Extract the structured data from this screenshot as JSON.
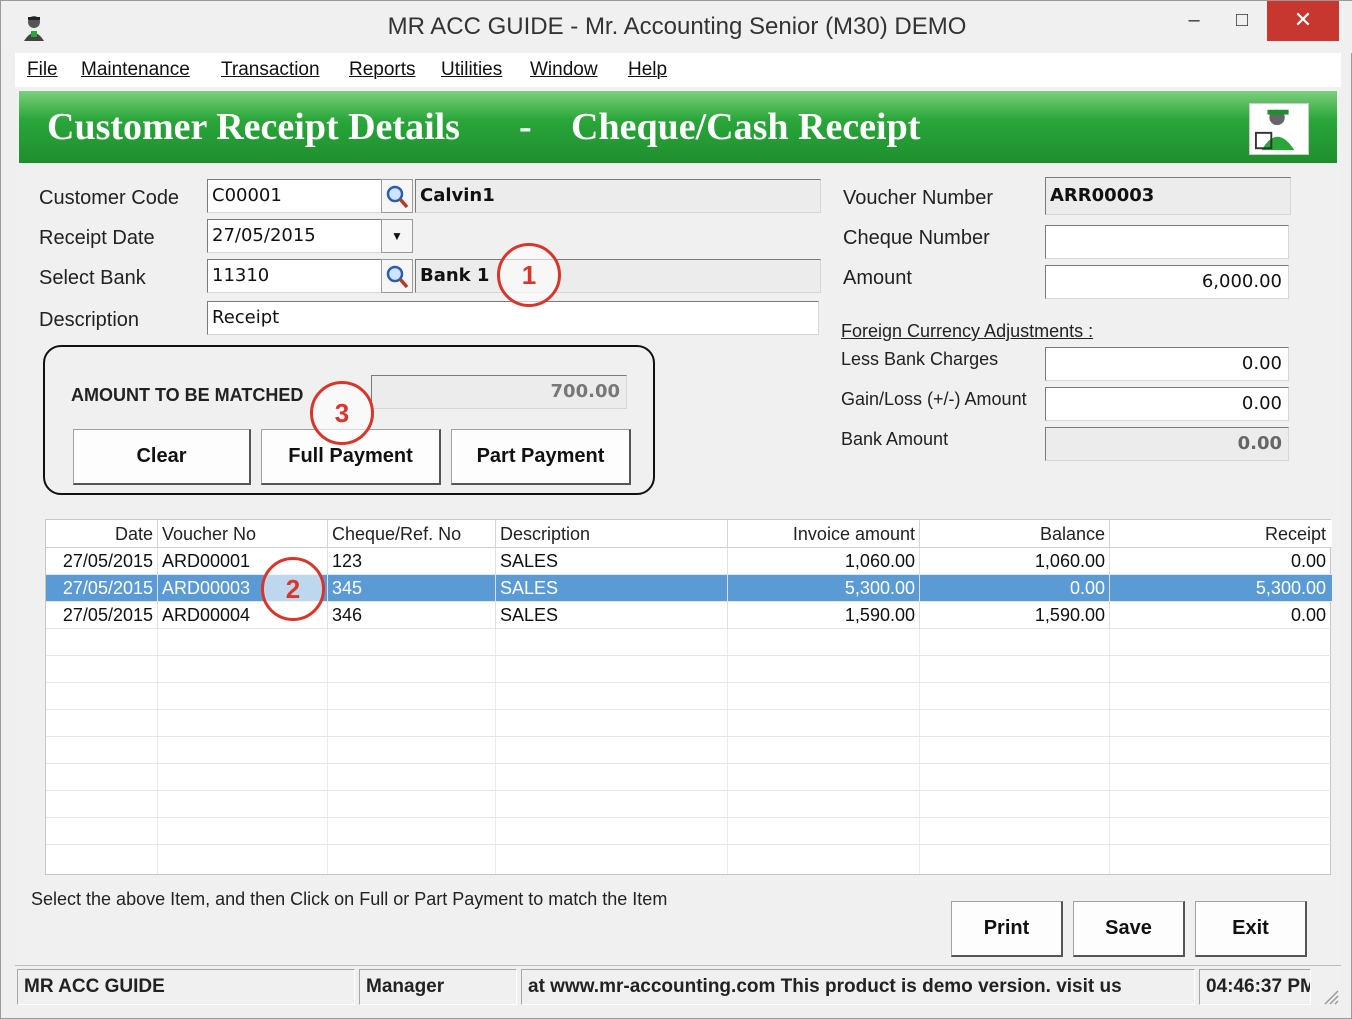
{
  "window": {
    "title": "MR ACC GUIDE - Mr. Accounting Senior (M30) DEMO",
    "min_glyph": "–",
    "max_glyph": "□",
    "close_glyph": "✕"
  },
  "menu": [
    "File",
    "Maintenance",
    "Transaction",
    "Reports",
    "Utilities",
    "Window",
    "Help"
  ],
  "banner": {
    "left": "Customer Receipt Details",
    "sep": "-",
    "right": "Cheque/Cash Receipt"
  },
  "form": {
    "customer_code_label": "Customer Code",
    "customer_code": "C00001",
    "customer_name": "Calvin1",
    "receipt_date_label": "Receipt Date",
    "receipt_date": "27/05/2015",
    "select_bank_label": "Select Bank",
    "bank_code": "11310",
    "bank_name": "Bank 1",
    "description_label": "Description",
    "description": "Receipt",
    "voucher_number_label": "Voucher Number",
    "voucher_number": "ARR00003",
    "cheque_number_label": "Cheque Number",
    "cheque_number": "",
    "amount_label": "Amount",
    "amount": "6,000.00",
    "foreign_label": "Foreign Currency Adjustments :",
    "less_bank_charges_label": "Less Bank Charges",
    "less_bank_charges": "0.00",
    "gain_loss_label": "Gain/Loss (+/-) Amount",
    "gain_loss": "0.00",
    "bank_amount_label": "Bank Amount",
    "bank_amount": "0.00"
  },
  "matching": {
    "label": "AMOUNT TO BE MATCHED",
    "value": "700.00",
    "clear": "Clear",
    "full_payment": "Full Payment",
    "part_payment": "Part Payment"
  },
  "markers": [
    "1",
    "2",
    "3"
  ],
  "table": {
    "columns": [
      "Date",
      "Voucher No",
      "Cheque/Ref. No",
      "Description",
      "Invoice amount",
      "Balance",
      "Receipt"
    ],
    "rows": [
      [
        "27/05/2015",
        "ARD00001",
        "123",
        "SALES",
        "1,060.00",
        "1,060.00",
        "0.00"
      ],
      [
        "27/05/2015",
        "ARD00003",
        "345",
        "SALES",
        "5,300.00",
        "0.00",
        "5,300.00"
      ],
      [
        "27/05/2015",
        "ARD00004",
        "346",
        "SALES",
        "1,590.00",
        "1,590.00",
        "0.00"
      ]
    ],
    "selected_row": 1
  },
  "hint": "Select the above Item, and then Click on Full or Part Payment to match the Item",
  "footer_buttons": {
    "print": "Print",
    "save": "Save",
    "exit": "Exit"
  },
  "status": {
    "app": "MR ACC GUIDE",
    "user": "Manager",
    "message": "at www.mr-accounting.com This product is demo version.  visit us",
    "time": "04:46:37 PM"
  },
  "colors": {
    "banner_green": "#1e8f2e",
    "selection_blue": "#5b9bd5",
    "marker_red": "#d9352b",
    "close_red": "#c7372f"
  }
}
